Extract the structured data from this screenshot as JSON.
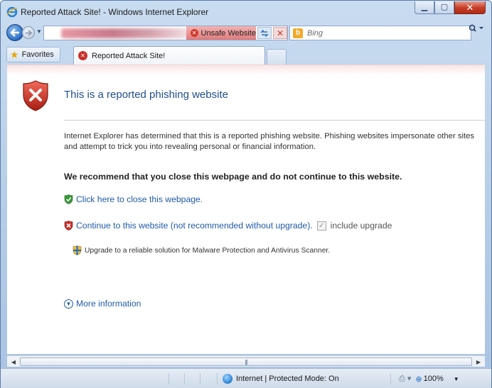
{
  "window": {
    "title": "Reported Attack Site! - Windows Internet Explorer"
  },
  "address_bar": {
    "security_badge": "Unsafe Website"
  },
  "search": {
    "placeholder": "Bing"
  },
  "toolbar": {
    "favorites_label": "Favorites"
  },
  "tab": {
    "title": "Reported Attack Site!"
  },
  "page": {
    "heading": "This is a reported phishing website",
    "description": "Internet Explorer has determined that this is a reported phishing website. Phishing websites impersonate other sites and attempt to trick you into revealing personal or financial information.",
    "recommendation": "We recommend that you close this webpage and do not continue to this website.",
    "close_link": "Click here to close this webpage.",
    "continue_link": "Continue to this website (not recommended without upgrade).",
    "upgrade_checkbox_label": "include upgrade",
    "upgrade_checked": true,
    "upgrade_text": "Upgrade to a reliable solution for Malware Protection and Antivirus Scanner.",
    "more_info_link": "More information"
  },
  "status_bar": {
    "zone_text": "Internet | Protected Mode: On",
    "zoom": "100%"
  },
  "colors": {
    "link": "#1f5ba8",
    "heading": "#1f4f8a",
    "danger": "#c8302a",
    "safe": "#3a9a3a"
  }
}
